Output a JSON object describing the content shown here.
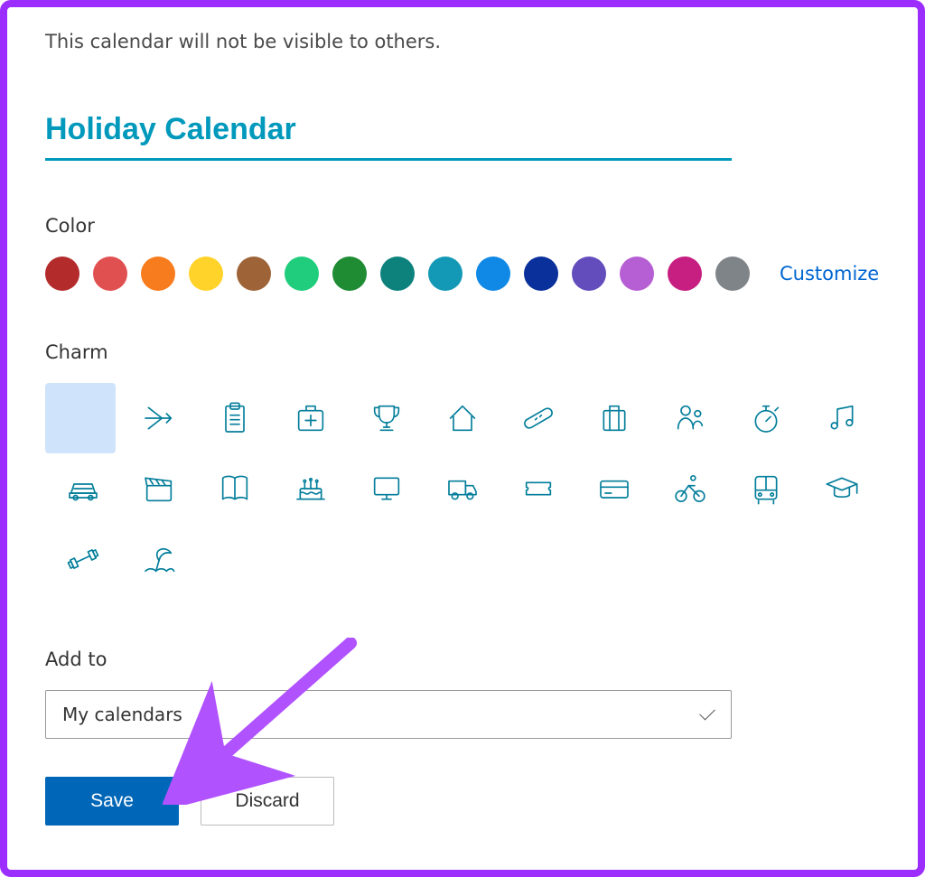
{
  "hint": "This calendar will not be visible to others.",
  "calendar_name": "Holiday Calendar",
  "sections": {
    "color_label": "Color",
    "charm_label": "Charm",
    "addto_label": "Add to"
  },
  "customize_label": "Customize",
  "colors": [
    "#b32b2b",
    "#e15051",
    "#f77c1d",
    "#ffd32a",
    "#9e6438",
    "#1fcd7c",
    "#1f8c34",
    "#0d827d",
    "#1399b6",
    "#0f88e6",
    "#09309b",
    "#634dbd",
    "#b65fd4",
    "#c61e81",
    "#7f8489"
  ],
  "charms": [
    {
      "name": "none",
      "selected": true
    },
    {
      "name": "airplane",
      "selected": false
    },
    {
      "name": "clipboard",
      "selected": false
    },
    {
      "name": "firstaid",
      "selected": false
    },
    {
      "name": "trophy",
      "selected": false
    },
    {
      "name": "home",
      "selected": false
    },
    {
      "name": "bandage",
      "selected": false
    },
    {
      "name": "suitcase",
      "selected": false
    },
    {
      "name": "people",
      "selected": false
    },
    {
      "name": "stopwatch",
      "selected": false
    },
    {
      "name": "music",
      "selected": false
    },
    {
      "name": "car",
      "selected": false
    },
    {
      "name": "clapper",
      "selected": false
    },
    {
      "name": "book",
      "selected": false
    },
    {
      "name": "cake",
      "selected": false
    },
    {
      "name": "monitor",
      "selected": false
    },
    {
      "name": "truck",
      "selected": false
    },
    {
      "name": "ticket",
      "selected": false
    },
    {
      "name": "creditcard",
      "selected": false
    },
    {
      "name": "cycling",
      "selected": false
    },
    {
      "name": "bus",
      "selected": false
    },
    {
      "name": "graduation",
      "selected": false
    },
    {
      "name": "barbell",
      "selected": false
    },
    {
      "name": "beach",
      "selected": false
    }
  ],
  "dropdown": {
    "value": "My calendars"
  },
  "buttons": {
    "save": "Save",
    "discard": "Discard"
  }
}
